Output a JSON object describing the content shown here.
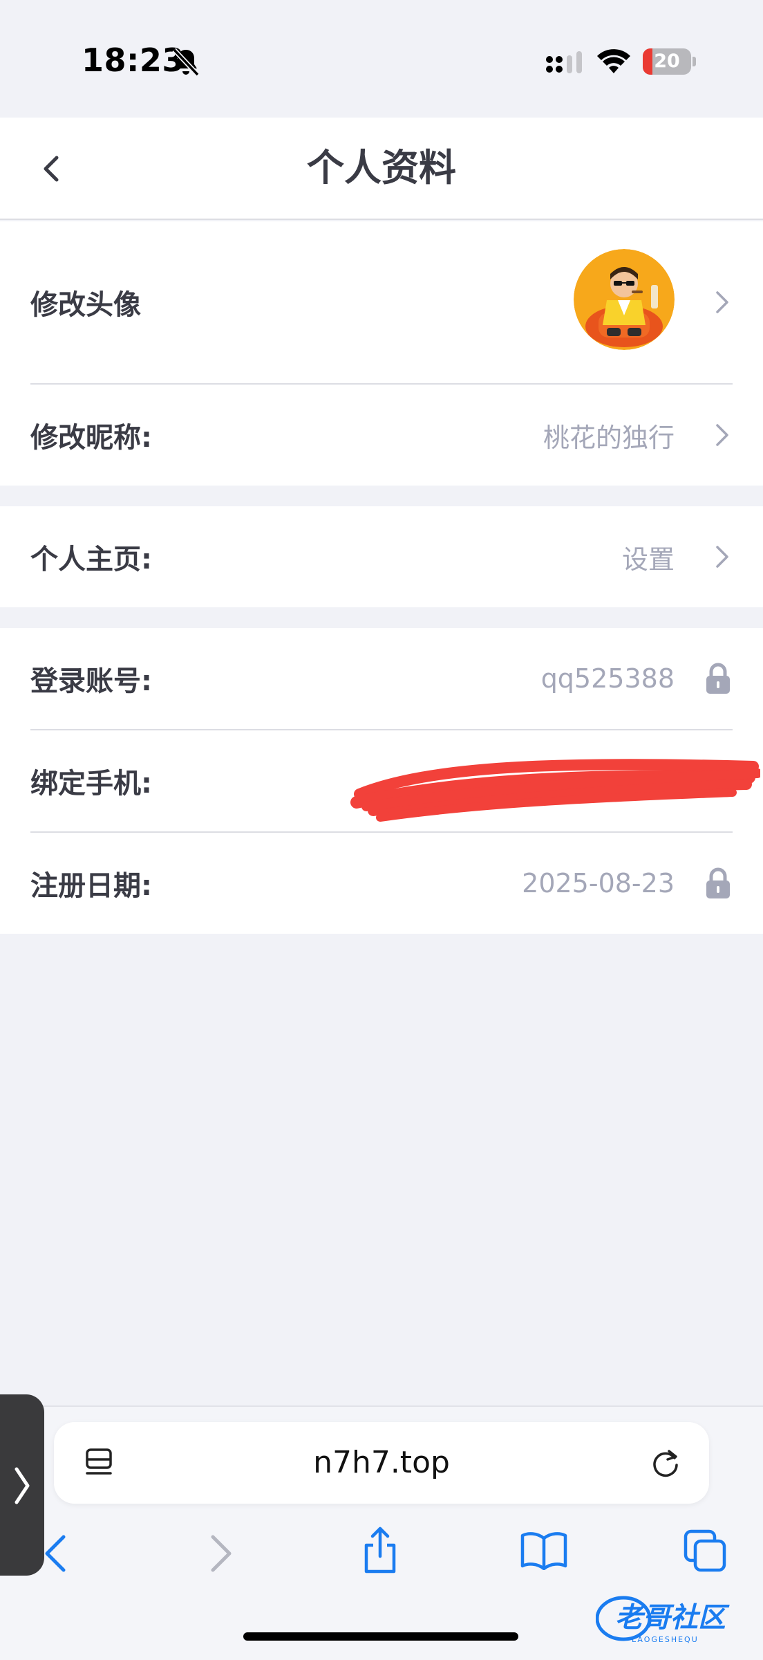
{
  "status_bar": {
    "time": "18:23",
    "battery_level": "20",
    "battery_fraction": 0.2,
    "icons": [
      "bell-slash-icon",
      "signal-icon",
      "wifi-icon",
      "battery-icon"
    ]
  },
  "header": {
    "title": "个人资料",
    "back_icon": "chevron-left-icon"
  },
  "profile": {
    "avatar_row": {
      "label": "修改头像"
    },
    "nickname_row": {
      "label": "修改昵称:",
      "value": "桃花的独行"
    }
  },
  "homepage": {
    "row": {
      "label": "个人主页:",
      "value": "设置"
    }
  },
  "account": {
    "login_row": {
      "label": "登录账号:",
      "value": "qq525388"
    },
    "phone_row": {
      "label": "绑定手机:",
      "value": ""
    },
    "register_row": {
      "label": "注册日期:",
      "value": "2025-08-23"
    }
  },
  "browser": {
    "url": "n7h7.top",
    "toolbar_icons": [
      "back-arrow-icon",
      "forward-arrow-icon",
      "share-icon",
      "bookmarks-icon",
      "tabs-icon"
    ]
  },
  "watermark": {
    "brand": "老哥社区",
    "sub": "LAOGESHEQU"
  },
  "colors": {
    "background": "#f1f2f7",
    "label": "#3a3b45",
    "value": "#a4a7b8",
    "accent": "#1a7cf0",
    "battery_low": "#ea3a33",
    "redaction": "#f2413a"
  }
}
